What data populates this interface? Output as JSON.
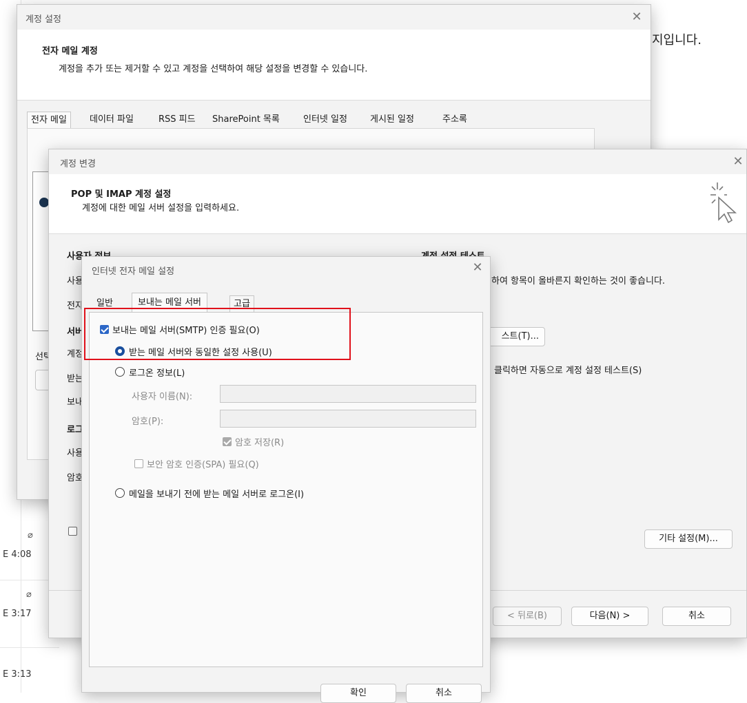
{
  "background": {
    "right_text": "지입니다.",
    "times": [
      "E 4:08",
      "E 3:17",
      "E 3:13"
    ]
  },
  "account_settings": {
    "title": "계정 설정",
    "heading": "전자 메일 계정",
    "description": "계정을 추가 또는 제거할 수 있고 계정을 선택하여 해당 설정을 변경할 수 있습니다.",
    "tabs": [
      "전자 메일",
      "데이터 파일",
      "RSS 피드",
      "SharePoint 목록",
      "인터넷 일정",
      "게시된 일정",
      "주소록"
    ],
    "partial_labels": [
      "선택"
    ]
  },
  "change_account": {
    "title": "계정 변경",
    "heading": "POP 및 IMAP 계정 설정",
    "subheading": "계정에 대한 메일 서버 설정을 입력하세요.",
    "user_info_label": "사용자 정보",
    "test_label": "계정 설정 테스트",
    "test_description_tail": "하여 항목이 올바른지 확인하는 것이 좋습니다.",
    "test_button_tail": "스트(T)...",
    "auto_test_tail": "클릭하면 자동으로 계정 설정 테스트(S)",
    "left_partial": [
      "사용",
      "전자",
      "서버",
      "계정",
      "받는",
      "보내",
      "로그",
      "사용",
      "암호"
    ],
    "more_settings": "기타 설정(M)...",
    "back": "< 뒤로(B)",
    "next": "다음(N) >",
    "cancel": "취소"
  },
  "internet_email": {
    "title": "인터넷 전자 메일 설정",
    "tabs": [
      "일반",
      "보내는 메일 서버",
      "고급"
    ],
    "smtp_auth_required": "보내는 메일 서버(SMTP) 인증 필요(O)",
    "use_same_settings": "받는 메일 서버와 동일한 설정 사용(U)",
    "logon_info": "로그온 정보(L)",
    "username_label": "사용자 이름(N):",
    "username_value": "",
    "password_label": "암호(P):",
    "password_value": "",
    "save_password": "암호 저장(R)",
    "spa_required": "보안 암호 인증(SPA) 필요(Q)",
    "logon_before_send": "메일을 보내기 전에 받는 메일 서버로 로그온(I)",
    "ok": "확인",
    "cancel": "취소"
  },
  "colors": {
    "accent": "#2c67c7",
    "highlight": "#e0101a"
  }
}
